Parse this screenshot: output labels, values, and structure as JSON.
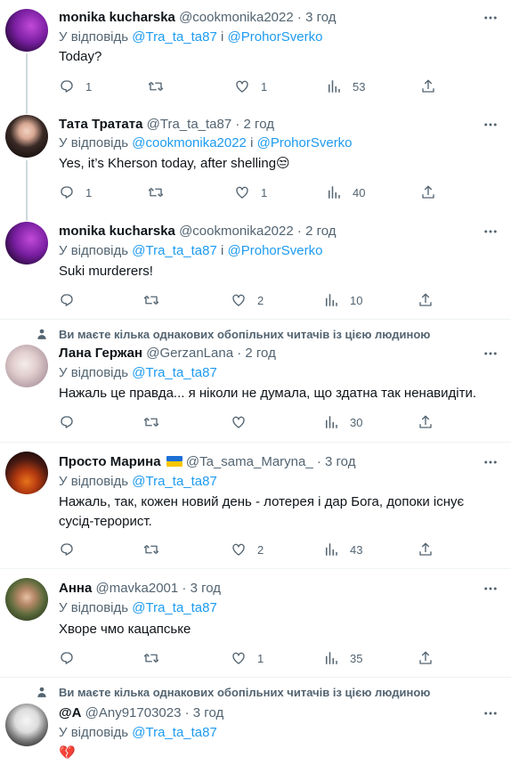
{
  "reply_prefix": "У відповідь",
  "and_word": "і",
  "social_context": "Ви маєте кілька однакових обопільних читачів із цією людиною",
  "tweets": [
    {
      "name": "monika kucharska",
      "handle": "@cookmonika2022",
      "time": "3 год",
      "reply_mentions": [
        "@Tra_ta_ta87",
        "@ProhorSverko"
      ],
      "text": "Today?",
      "replies": "1",
      "retweets": "",
      "likes": "1",
      "views": "53"
    },
    {
      "name": "Тата Тратата",
      "handle": "@Tra_ta_ta87",
      "time": "2 год",
      "reply_mentions": [
        "@cookmonika2022",
        "@ProhorSverko"
      ],
      "text": "Yes, it’s Kherson today, after shelling😒",
      "replies": "1",
      "retweets": "",
      "likes": "1",
      "views": "40"
    },
    {
      "name": "monika kucharska",
      "handle": "@cookmonika2022",
      "time": "2 год",
      "reply_mentions": [
        "@Tra_ta_ta87",
        "@ProhorSverko"
      ],
      "text": "Suki murderers!",
      "replies": "",
      "retweets": "",
      "likes": "2",
      "views": "10"
    },
    {
      "name": "Лана Гержан",
      "handle": "@GerzanLana",
      "time": "2 год",
      "reply_mentions": [
        "@Tra_ta_ta87"
      ],
      "text": "Нажаль це правда... я ніколи не думала, що здатна так ненавидіти.",
      "replies": "",
      "retweets": "",
      "likes": "",
      "views": "30"
    },
    {
      "name": "Просто Марина",
      "handle": "@Ta_sama_Maryna_",
      "time": "3 год",
      "reply_mentions": [
        "@Tra_ta_ta87"
      ],
      "text": "Нажаль, так, кожен новий день - лотерея і дар Бога, допоки існує сусід-терорист.",
      "replies": "",
      "retweets": "",
      "likes": "2",
      "views": "43"
    },
    {
      "name": "Анна",
      "handle": "@mavka2001",
      "time": "3 год",
      "reply_mentions": [
        "@Tra_ta_ta87"
      ],
      "text": "Хворе чмо кацапське",
      "replies": "",
      "retweets": "",
      "likes": "1",
      "views": "35"
    },
    {
      "name": "@A",
      "handle": "@Any91703023",
      "time": "3 год",
      "reply_mentions": [
        "@Tra_ta_ta87"
      ],
      "text": "💔",
      "replies": "",
      "retweets": "",
      "likes": "",
      "views": ""
    }
  ],
  "colors": {
    "text": "#0f1419",
    "secondary": "#536471",
    "link": "#1d9bf0",
    "divider": "#eff3f4",
    "thread_line": "#cfd9de"
  },
  "icons": [
    "reply-icon",
    "retweet-icon",
    "like-icon",
    "views-icon",
    "share-icon",
    "more-icon",
    "person-icon",
    "ukraine-flag-icon"
  ]
}
